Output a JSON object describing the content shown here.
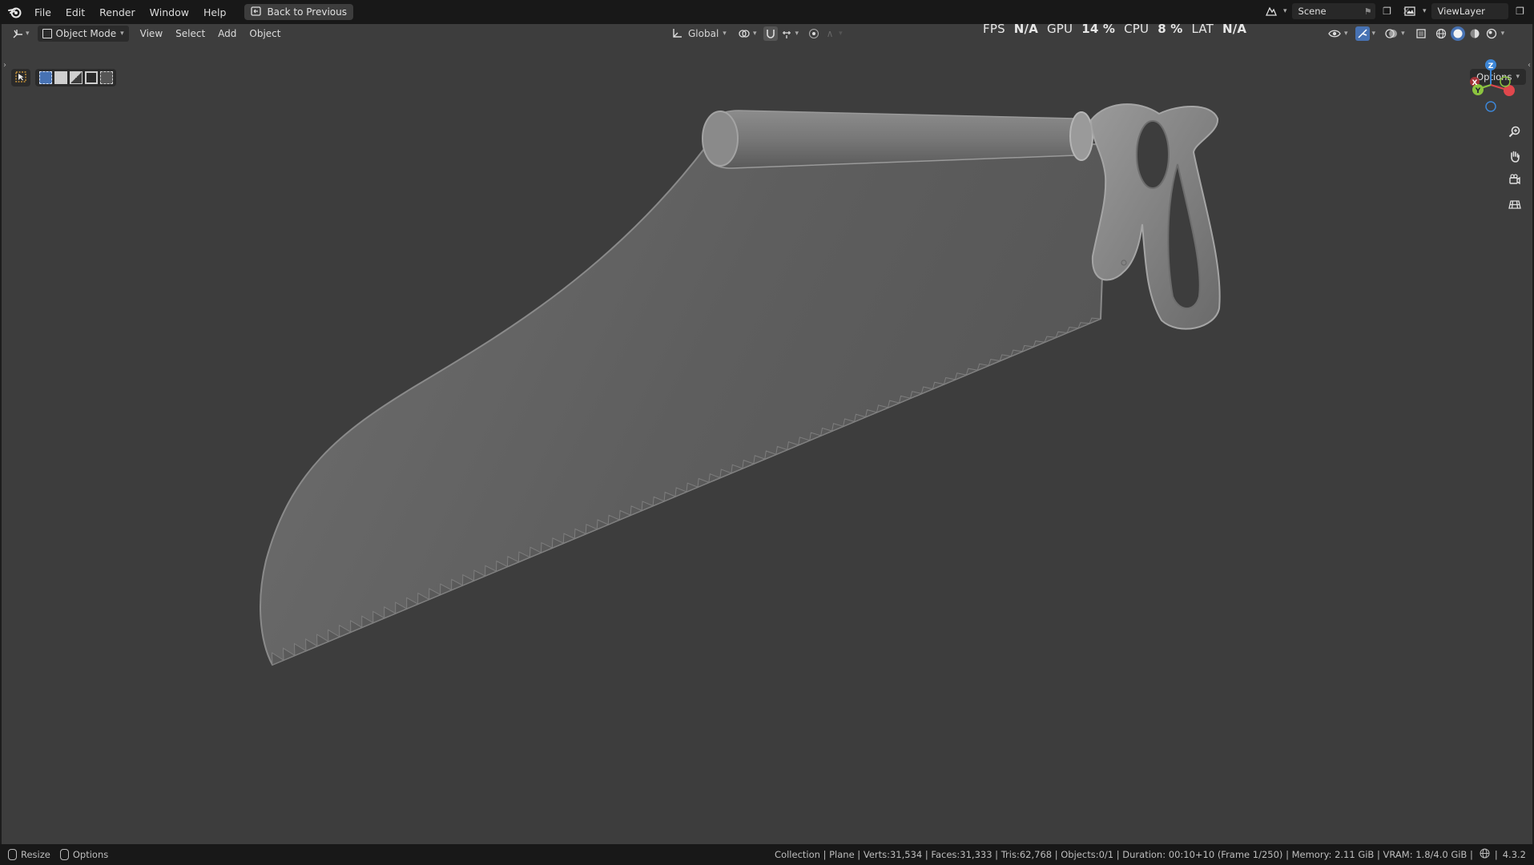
{
  "topbar": {
    "menus": [
      "File",
      "Edit",
      "Render",
      "Window",
      "Help"
    ],
    "back_button": "Back to Previous",
    "scene_label": "Scene",
    "viewlayer_label": "ViewLayer"
  },
  "header3d": {
    "mode": "Object Mode",
    "menus": [
      "View",
      "Select",
      "Add",
      "Object"
    ],
    "orientation": "Global",
    "options_label": "Options"
  },
  "perf": {
    "fps_label": "FPS",
    "fps_value": "N/A",
    "gpu_label": "GPU",
    "gpu_value": "14 %",
    "cpu_label": "CPU",
    "cpu_value": "8 %",
    "lat_label": "LAT",
    "lat_value": "N/A"
  },
  "gizmo": {
    "z": "Z",
    "y": "Y",
    "x": "X"
  },
  "statusbar": {
    "left_resize": "Resize",
    "left_options": "Options",
    "info": "Collection | Plane | Verts:31,534 | Faces:31,333 | Tris:62,768 | Objects:0/1 | Duration: 00:10+10 (Frame 1/250) | Memory: 2.11 GiB | VRAM: 1.8/4.0 GiB |",
    "version": "4.3.2"
  },
  "icons": {
    "logo": "blender-logo-icon",
    "back": "back-window-icon",
    "zoom": "magnifier-icon",
    "pan": "hand-icon",
    "camera": "camera-icon",
    "ortho": "grid-icon"
  },
  "colors": {
    "viewport_bg": "#3d3d3d",
    "topbar_bg": "#181818",
    "accent_blue": "#4772b3",
    "axis_x": "#e0474c",
    "axis_y": "#8cc43f",
    "axis_z": "#3d86d6",
    "model_gray": "#8a8a8a"
  }
}
